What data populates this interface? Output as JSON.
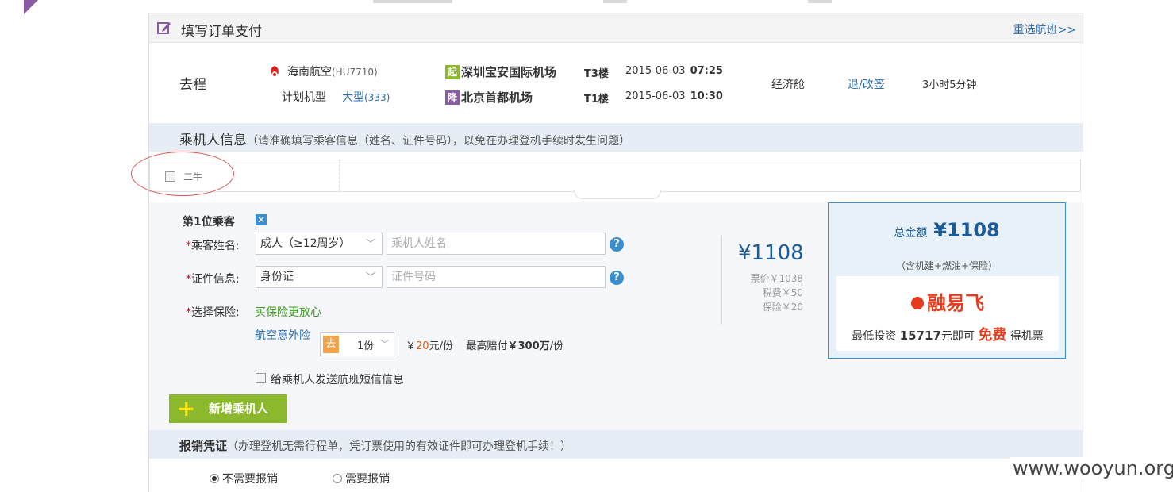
{
  "header": {
    "title": "填写订单支付",
    "reselect": "重选航班>>"
  },
  "flight": {
    "direction": "去程",
    "airline": "海南航空",
    "flight_no": "(HU7710)",
    "plan_label": "计划机型",
    "plane_size": "大型",
    "plane_code": "(333)",
    "dep_badge": "起",
    "dep_airport": "深圳宝安国际机场",
    "dep_terminal": "T3楼",
    "dep_date": "2015-06-03",
    "dep_time": "07:25",
    "arr_badge": "降",
    "arr_airport": "北京首都机场",
    "arr_terminal": "T1楼",
    "arr_date": "2015-06-03",
    "arr_time": "10:30",
    "cabin": "经济舱",
    "refund": "退/改签",
    "duration": "3小时5分钟"
  },
  "passenger_section": {
    "title": "乘机人信息",
    "note": "（请准确填写乘客信息（姓名、证件号码），以免在办理登机手续时发生问题）"
  },
  "saved_passengers": [
    {
      "name": "二牛"
    }
  ],
  "form": {
    "passenger_heading": "第1位乘客",
    "close_glyph": "✕",
    "required_mark": "*",
    "name_label": "乘客姓名:",
    "age_type": "成人（≥12周岁）",
    "name_placeholder": "乘机人姓名",
    "id_label": "证件信息:",
    "id_type": "身份证",
    "id_placeholder": "证件号码",
    "insurance_label": "选择保险:",
    "insurance_promo": "买保险更放心",
    "insurance_name": "航空意外险",
    "insurance_go": "去",
    "insurance_count": "1份",
    "insurance_price_prefix": "￥",
    "insurance_price": "20",
    "insurance_price_suffix": "元/份",
    "insurance_max": "最高赔付",
    "insurance_max_value": "￥300万",
    "insurance_max_suffix": "/份",
    "sms_label": "给乘机人发送航班短信信息",
    "help_glyph": "?"
  },
  "price": {
    "main": "¥1108",
    "ticket": "票价￥1038",
    "tax": "税费￥50",
    "insurance": "保险￥20"
  },
  "total": {
    "label": "总金额",
    "value": "¥1108",
    "sub": "（含机建+燃油+保险）"
  },
  "promo": {
    "logo": "融易飞",
    "text_prefix": "最低投资",
    "amount": "15717",
    "text_mid": "元即可",
    "free": "免费",
    "text_suffix": "得机票"
  },
  "add_passenger": {
    "label": "新增乘机人",
    "icon": "+"
  },
  "reimburse_section": {
    "title": "报销凭证",
    "note": "（办理登机无需行程单，凭订票使用的有效证件即可办理登机手续！）",
    "options": [
      {
        "label": "不需要报销",
        "selected": true
      },
      {
        "label": "需要报销",
        "selected": false
      }
    ]
  },
  "watermark": "www.wooyun.org",
  "colors": {
    "accent": "#2f6fae",
    "green": "#8cb82d",
    "purple": "#8a5ba5",
    "red": "#e53a1e"
  }
}
